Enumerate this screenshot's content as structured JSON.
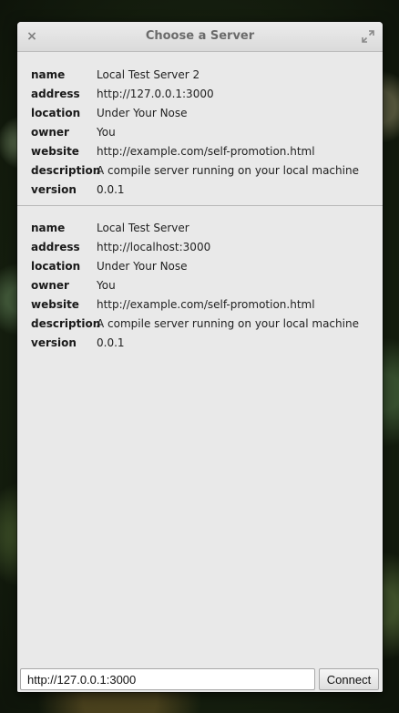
{
  "window": {
    "title": "Choose a Server",
    "close_glyph": "×",
    "maximize_icon": "maximize-icon"
  },
  "servers": [
    {
      "name": "Local Test Server 2",
      "address": "http://127.0.0.1:3000",
      "location": "Under Your Nose",
      "owner": "You",
      "website": "http://example.com/self-promotion.html",
      "description": "A compile server running on your local machine",
      "version": "0.0.1"
    },
    {
      "name": "Local Test Server",
      "address": "http://localhost:3000",
      "location": "Under Your Nose",
      "owner": "You",
      "website": "http://example.com/self-promotion.html",
      "description": "A compile server running on your local machine",
      "version": "0.0.1"
    }
  ],
  "field_labels": {
    "name": "name",
    "address": "address",
    "location": "location",
    "owner": "owner",
    "website": "website",
    "description": "description",
    "version": "version"
  },
  "footer": {
    "url_value": "http://127.0.0.1:3000",
    "connect_label": "Connect"
  }
}
